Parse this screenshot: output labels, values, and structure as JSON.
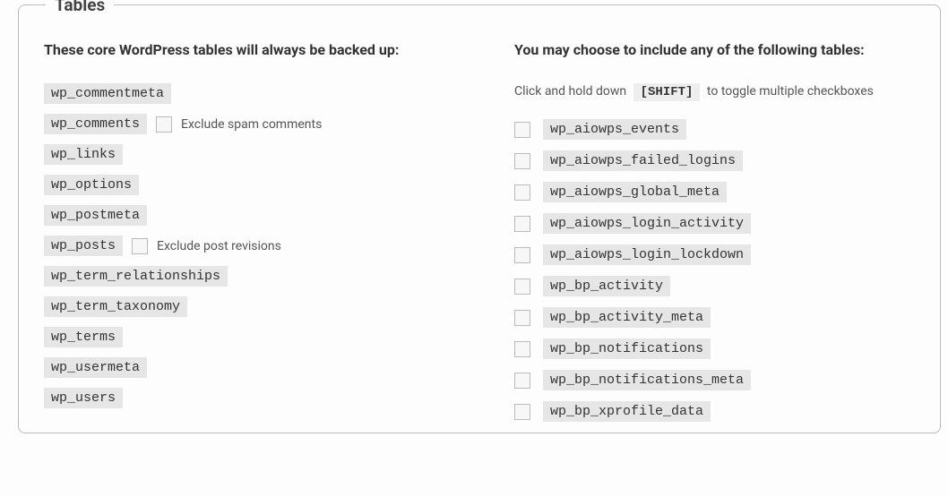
{
  "section_title": "Tables",
  "left": {
    "heading": "These core WordPress tables will always be backed up:",
    "core_tables": [
      {
        "name": "wp_commentmeta"
      },
      {
        "name": "wp_comments",
        "option_label": "Exclude spam comments"
      },
      {
        "name": "wp_links"
      },
      {
        "name": "wp_options"
      },
      {
        "name": "wp_postmeta"
      },
      {
        "name": "wp_posts",
        "option_label": "Exclude post revisions"
      },
      {
        "name": "wp_term_relationships"
      },
      {
        "name": "wp_term_taxonomy"
      },
      {
        "name": "wp_terms"
      },
      {
        "name": "wp_usermeta"
      },
      {
        "name": "wp_users"
      }
    ]
  },
  "right": {
    "heading": "You may choose to include any of the following tables:",
    "hint_prefix": "Click and hold down",
    "hint_kbd": "[SHIFT]",
    "hint_suffix": "to toggle multiple checkboxes",
    "optional_tables": [
      "wp_aiowps_events",
      "wp_aiowps_failed_logins",
      "wp_aiowps_global_meta",
      "wp_aiowps_login_activity",
      "wp_aiowps_login_lockdown",
      "wp_bp_activity",
      "wp_bp_activity_meta",
      "wp_bp_notifications",
      "wp_bp_notifications_meta",
      "wp_bp_xprofile_data"
    ]
  }
}
